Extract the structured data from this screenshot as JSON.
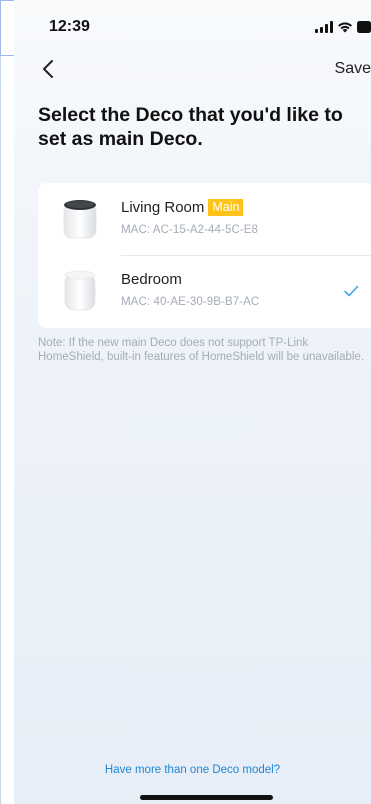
{
  "status_bar": {
    "time": "12:39"
  },
  "nav": {
    "save_label": "Save"
  },
  "title": "Select the Deco that you'd like to set as main Deco.",
  "devices": [
    {
      "name": "Living Room",
      "badge": "Main",
      "mac": "MAC: AC-15-A2-44-5C-E8",
      "selected": false,
      "icon": "deco-dark-top-icon"
    },
    {
      "name": "Bedroom",
      "badge": "",
      "mac": "MAC: 40-AE-30-9B-B7-AC",
      "selected": true,
      "icon": "deco-white-icon"
    }
  ],
  "note": "Note: If the new main Deco does not support TP-Link HomeShield, built-in features of HomeShield will be unavailable.",
  "footer_link": "Have more than one Deco model?",
  "colors": {
    "badge": "#ffc21a",
    "check": "#3aa6e8",
    "link": "#1e86d6"
  }
}
